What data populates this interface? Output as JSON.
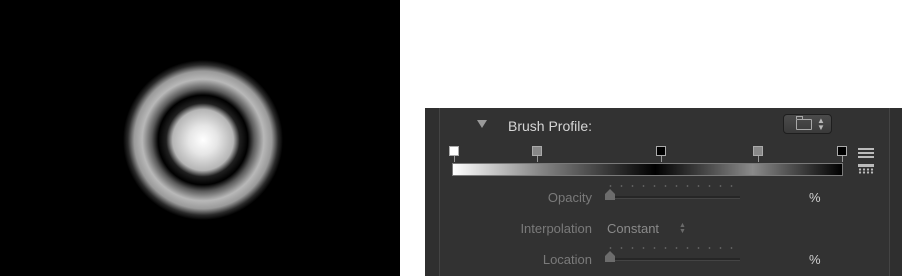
{
  "canvas_preview": {
    "background": "#000000",
    "rings": "white-black-white radial brush falloff"
  },
  "inspector": {
    "section_title": "Brush Profile:",
    "preset_popup": {
      "icon": "folder-icon"
    },
    "gradient": {
      "tags": [
        {
          "name": "white-stop",
          "color": "#ffffff"
        },
        {
          "name": "gray-stop-1",
          "color": "#888888"
        },
        {
          "name": "black-stop-1",
          "color": "#000000"
        },
        {
          "name": "gray-stop-2",
          "color": "#888888"
        },
        {
          "name": "black-stop-2",
          "color": "#000000"
        }
      ]
    },
    "rows": {
      "opacity": {
        "label": "Opacity",
        "unit": "%",
        "value_fraction": 0.0
      },
      "interpolation": {
        "label": "Interpolation",
        "value": "Constant"
      },
      "location": {
        "label": "Location",
        "unit": "%",
        "value_fraction": 0.0
      }
    }
  }
}
